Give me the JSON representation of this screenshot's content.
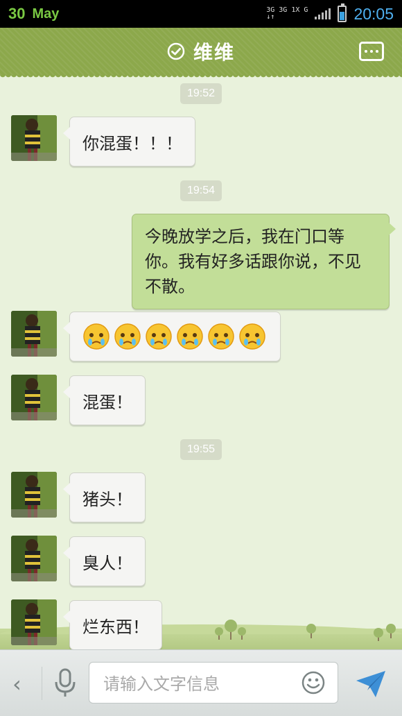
{
  "status_bar": {
    "day": "30",
    "month": "May",
    "network_line1": "3G 3G 1X G",
    "network_line2": "↓↑",
    "time": "20:05"
  },
  "header": {
    "title": "维维",
    "title_icon": "check-circle-icon",
    "more_icon": "more-dots-icon"
  },
  "chat": {
    "timestamps": [
      "19:52",
      "19:54",
      "19:55"
    ],
    "messages": [
      {
        "from": "contact",
        "text": "你混蛋！！！"
      },
      {
        "from": "me",
        "text": "今晚放学之后，我在门口等你。我有好多话跟你说，不见不散。"
      },
      {
        "from": "contact",
        "emoji": "crying-face",
        "count": 6
      },
      {
        "from": "contact",
        "text": "混蛋！"
      },
      {
        "from": "contact",
        "text": "猪头！"
      },
      {
        "from": "contact",
        "text": "臭人！"
      },
      {
        "from": "contact",
        "text": "烂东西！"
      }
    ]
  },
  "input_bar": {
    "placeholder": "请输入文字信息",
    "value": "",
    "back_icon": "chevron-left-icon",
    "mic_icon": "microphone-icon",
    "emoji_icon": "smiley-icon",
    "send_icon": "paper-plane-icon"
  },
  "colors": {
    "header": "#8ca84b",
    "chat_bg": "#e9f2dc",
    "outgoing_bubble": "#c2de98",
    "incoming_bubble": "#f5f5f3",
    "time_badge": "#d5dbc8",
    "send_icon": "#3d8fd6"
  }
}
